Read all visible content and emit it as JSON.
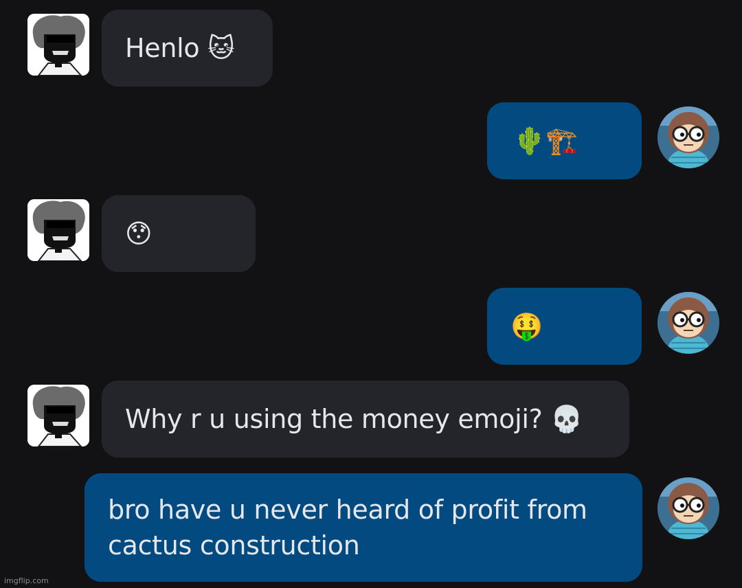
{
  "messages": [
    {
      "from": "them",
      "avatar": "bw-dark-hair-avatar",
      "text": "Henlo 🐱"
    },
    {
      "from": "me",
      "avatar": "cartoon-monkey-glasses-avatar",
      "text": "🌵🏗️"
    },
    {
      "from": "them",
      "avatar": "bw-dark-hair-avatar",
      "text": "😯"
    },
    {
      "from": "me",
      "avatar": "cartoon-monkey-glasses-avatar",
      "text": "🤑"
    },
    {
      "from": "them",
      "avatar": "bw-dark-hair-avatar",
      "text": "Why r u using the money emoji? 💀"
    },
    {
      "from": "me",
      "avatar": "cartoon-monkey-glasses-avatar",
      "text": "bro have u never heard of profit from\ncactus construction"
    }
  ],
  "watermark": "imgflip.com",
  "colors": {
    "background": "#121214",
    "incoming_bubble": "#23252a",
    "outgoing_bubble": "#024a80",
    "text": "#e6e7ea"
  }
}
